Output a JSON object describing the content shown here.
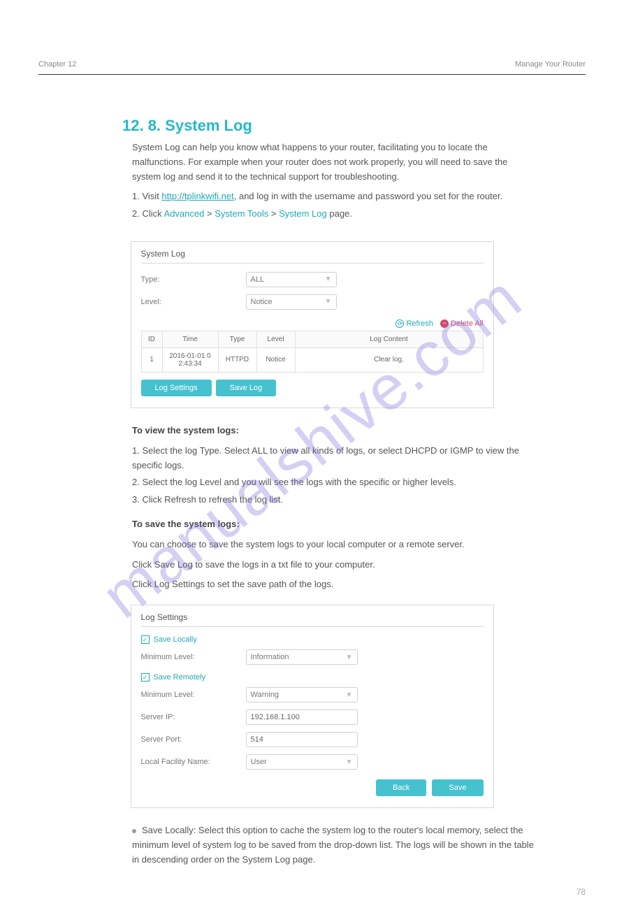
{
  "header": {
    "chapter_left": "Chapter 12",
    "chapter_right": "Manage Your Router"
  },
  "section": {
    "heading": "12. 8.   System Log",
    "intro": "System Log can help you know what happens to your router, facilitating you to locate the malfunctions. For example when your router does not work properly, you will need to save the system log and send it to the technical support for troubleshooting.",
    "step1_prefix": "1. ",
    "step1_text": "Visit ",
    "step1_link": "http://tplinkwifi.net",
    "step1_suffix": ", and log in with the username and password you set for the router.",
    "step2_prefix": "2. ",
    "step2_text": "Click ",
    "step2_hl1": "Advanced",
    "step2_mid": " > ",
    "step2_hl2": "System Tools",
    "step2_mid2": " > ",
    "step2_hl3": "System Log",
    "step2_suffix": " page."
  },
  "panel1": {
    "title": "System Log",
    "type_label": "Type:",
    "type_value": "ALL",
    "level_label": "Level:",
    "level_value": "Notice",
    "refresh": "Refresh",
    "delete_all": "Delete All",
    "th_id": "ID",
    "th_time": "Time",
    "th_type": "Type",
    "th_level": "Level",
    "th_content": "Log Content",
    "r1_id": "1",
    "r1_time": "2016-01-01 0\n2:43:34",
    "r1_type": "HTTPD",
    "r1_level": "Notice",
    "r1_content": "Clear log.",
    "btn_log_settings": "Log Settings",
    "btn_save_log": "Save Log"
  },
  "to_view": {
    "heading": "To view the system logs:",
    "l1": "1. Select the log Type. Select ALL to view all kinds of logs, or select DHCPD or IGMP to view the specific logs.",
    "l2": "2. Select the log Level and you will see the logs with the specific or higher levels.",
    "l3": "3. Click Refresh to refresh the log list."
  },
  "to_save": {
    "heading": "To save the system logs:",
    "intro": "You can choose to save the system logs to your local computer or a remote server.",
    "save_instr": "Click Save Log to save the logs in a txt file to your computer.",
    "settings_instr": "Click Log Settings to set the save path of the logs."
  },
  "panel2": {
    "title": "Log Settings",
    "save_locally": "Save Locally",
    "min_level1_label": "Minimum Level:",
    "min_level1_value": "Information",
    "save_remotely": "Save Remotely",
    "min_level2_label": "Minimum Level:",
    "min_level2_value": "Warning",
    "server_ip_label": "Server IP:",
    "server_ip_value": "192.168.1.100",
    "server_port_label": "Server Port:",
    "server_port_value": "514",
    "facility_label": "Local Facility Name:",
    "facility_value": "User",
    "btn_back": "Back",
    "btn_save": "Save"
  },
  "bullets": {
    "b1": "Save Locally: Select this option to cache the system log to the router's local memory, select the minimum level of system log to be saved from the drop-down list. The logs will be shown in the table in descending order on the System Log page."
  },
  "page_number": "78",
  "watermark": "manualshive.com"
}
